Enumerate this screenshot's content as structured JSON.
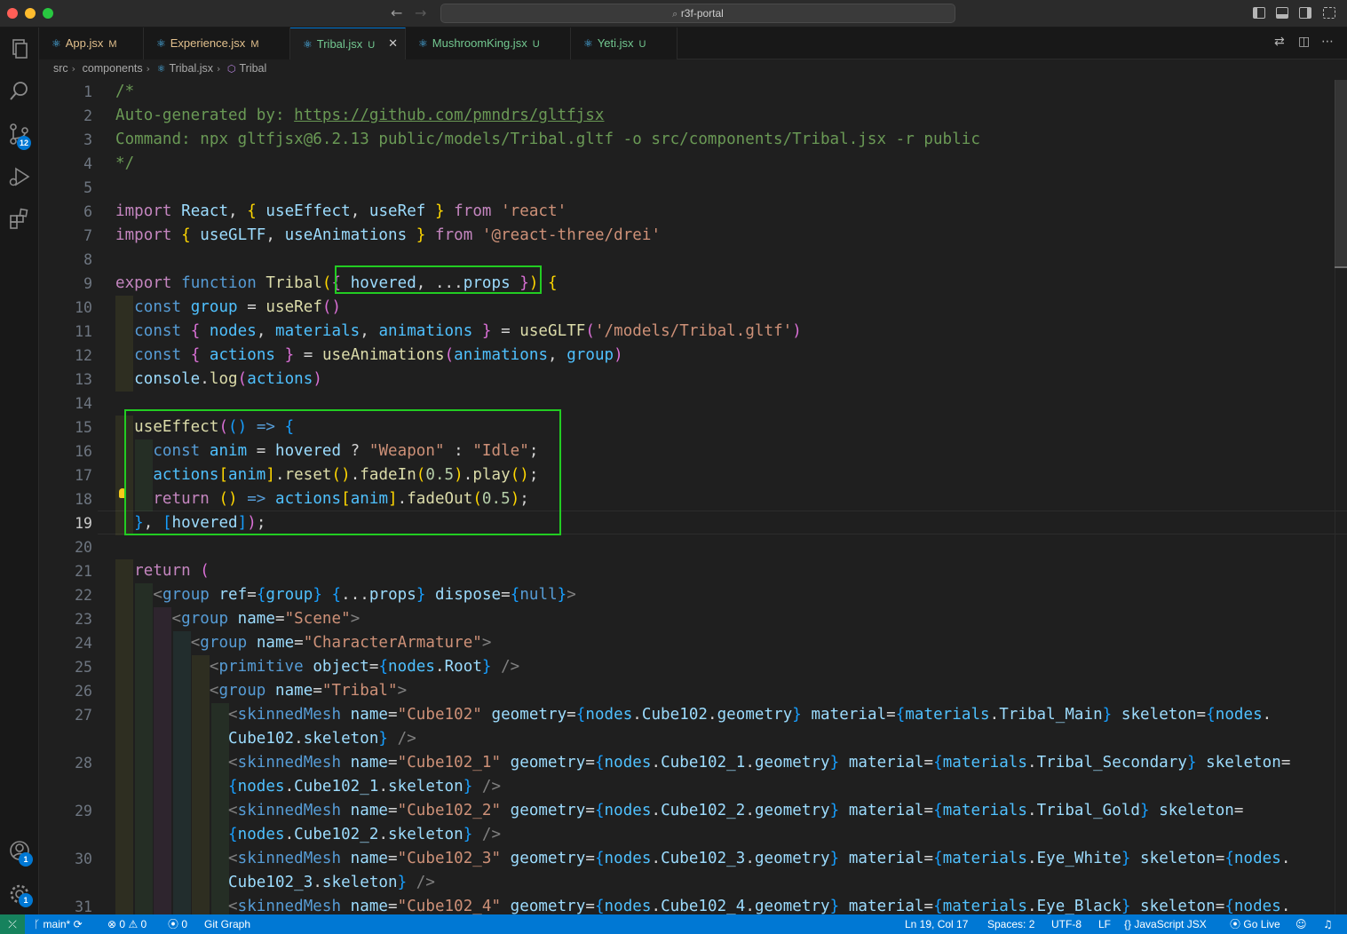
{
  "window": {
    "title": "r3f-portal"
  },
  "activity": {
    "scm_badge": "12",
    "accounts_badge": "1",
    "manage_badge": "1"
  },
  "tabs": [
    {
      "label": "App.jsx",
      "status": "M"
    },
    {
      "label": "Experience.jsx",
      "status": "M"
    },
    {
      "label": "Tribal.jsx",
      "status": "U",
      "active": true
    },
    {
      "label": "MushroomKing.jsx",
      "status": "U"
    },
    {
      "label": "Yeti.jsx",
      "status": "U"
    }
  ],
  "breadcrumb": {
    "folder1": "src",
    "folder2": "components",
    "file": "Tribal.jsx",
    "symbol": "Tribal"
  },
  "editor": {
    "current_line": 19,
    "line_numbers": [
      "1",
      "2",
      "3",
      "4",
      "5",
      "6",
      "7",
      "8",
      "9",
      "10",
      "11",
      "12",
      "13",
      "14",
      "15",
      "16",
      "17",
      "18",
      "19",
      "20",
      "21",
      "22",
      "23",
      "24",
      "25",
      "26",
      "27",
      "",
      "28",
      "",
      "29",
      "",
      "30",
      "",
      "31"
    ]
  },
  "code": {
    "l1": "/*",
    "l2_prefix": "Auto-generated by: ",
    "l2_url": "https://github.com/pmndrs/gltfjsx",
    "l3": "Command: npx gltfjsx@6.2.13 public/models/Tribal.gltf -o src/components/Tribal.jsx -r public",
    "l4": "*/",
    "l6_s": "'react'",
    "l7_s": "'@react-three/drei'",
    "l11_s": "'/models/Tribal.gltf'",
    "l16_s1": "\"Weapon\"",
    "l16_s2": "\"Idle\"",
    "l17_n": "0.5",
    "l23_s": "\"Scene\"",
    "l24_s": "\"CharacterArmature\"",
    "l26_s": "\"Tribal\"",
    "l27_s": "\"Cube102\"",
    "l28_s": "\"Cube102_1\"",
    "l29_s": "\"Cube102_2\"",
    "l30_s": "\"Cube102_3\"",
    "l31_s": "\"Cube102_4\""
  },
  "status": {
    "branch": "main*",
    "errors": "0",
    "warnings": "0",
    "ports": "0",
    "git_graph": "Git Graph",
    "position": "Ln 19, Col 17",
    "spaces": "Spaces: 2",
    "encoding": "UTF-8",
    "eol": "LF",
    "language": "JavaScript JSX",
    "golive": "Go Live"
  }
}
